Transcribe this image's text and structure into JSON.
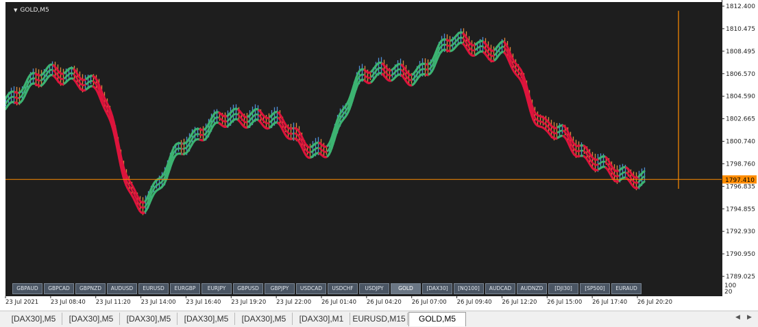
{
  "chart_title": "GOLD,M5",
  "price_axis": {
    "labels": [
      "1812.400",
      "1810.475",
      "1808.495",
      "1806.570",
      "1804.590",
      "1802.665",
      "1800.740",
      "1798.760",
      "1796.835",
      "1794.855",
      "1792.930",
      "1790.950",
      "1789.025"
    ],
    "current_price": "1797.410",
    "volume_labels": [
      "100",
      "20"
    ]
  },
  "time_axis": {
    "labels": [
      "23 Jul 2021",
      "23 Jul 08:40",
      "23 Jul 11:20",
      "23 Jul 14:00",
      "23 Jul 16:40",
      "23 Jul 19:20",
      "23 Jul 22:00",
      "26 Jul 01:40",
      "26 Jul 04:20",
      "26 Jul 07:00",
      "26 Jul 09:40",
      "26 Jul 12:20",
      "26 Jul 15:00",
      "26 Jul 17:40",
      "26 Jul 20:20"
    ]
  },
  "symbol_buttons": [
    "GBPAUD",
    "GBPCAD",
    "GBPNZD",
    "AUDUSD",
    "EURUSD",
    "EURGBP",
    "EURJPY",
    "GBPUSD",
    "GBPJPY",
    "USDCAD",
    "USDCHF",
    "USDJPY",
    "GOLD",
    "[DAX30]",
    "[NQ100]",
    "AUDCAD",
    "AUDNZD",
    "[DJI30]",
    "[SP500]",
    "EURAUD"
  ],
  "active_symbol": "GOLD",
  "tabs": [
    "[DAX30],M5",
    "[DAX30],M5",
    "[DAX30],M5",
    "[DAX30],M5",
    "[DAX30],M5",
    "[DAX30],M1",
    "EURUSD,M15",
    "GOLD,M5"
  ],
  "active_tab": "GOLD,M5",
  "colors": {
    "background": "#1e1e1e",
    "bull_band": "#3cb371",
    "bear_band": "#dc143c",
    "price_line": "#ff8c00",
    "bar_blue": "#4f8fd6",
    "bar_orange": "#e08a3c"
  },
  "chart_data": {
    "type": "line",
    "title": "GOLD,M5",
    "ylim": [
      1789.025,
      1812.4
    ],
    "x": [
      "23 Jul 2021",
      "23 Jul 08:40",
      "23 Jul 11:20",
      "23 Jul 14:00",
      "23 Jul 16:40",
      "23 Jul 19:20",
      "23 Jul 22:00",
      "26 Jul 01:40",
      "26 Jul 04:20",
      "26 Jul 07:00",
      "26 Jul 09:40",
      "26 Jul 12:20",
      "26 Jul 15:00",
      "26 Jul 17:40",
      "26 Jul 20:20"
    ],
    "series": [
      {
        "values": [
          1804.1,
          1806.9,
          1805.6,
          1795.2,
          1800.7,
          1803.1,
          1802.5,
          1799.8,
          1806.8,
          1806.6,
          1809.4,
          1808.6,
          1802.2,
          1799.3,
          1797.4
        ]
      }
    ],
    "current_price": 1797.41,
    "grid": false
  }
}
